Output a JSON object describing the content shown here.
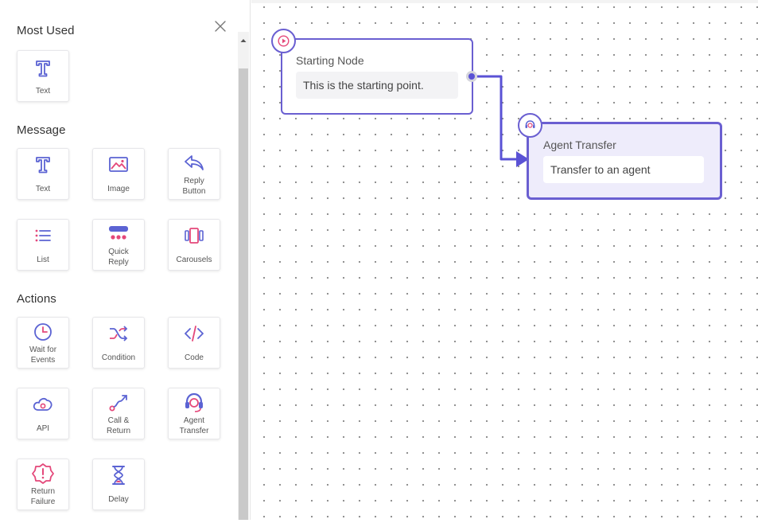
{
  "sidebar": {
    "sections": {
      "most_used": "Most Used",
      "message": "Message",
      "actions": "Actions"
    },
    "most_used_items": [
      {
        "label": "Text",
        "icon": "text-icon"
      }
    ],
    "message_items": [
      {
        "label": "Text",
        "icon": "text-icon"
      },
      {
        "label": "Image",
        "icon": "image-icon"
      },
      {
        "label": "Reply\nButton",
        "icon": "reply-icon"
      },
      {
        "label": "List",
        "icon": "list-icon"
      },
      {
        "label": "Quick\nReply",
        "icon": "quick-reply-icon"
      },
      {
        "label": "Carousels",
        "icon": "carousel-icon"
      }
    ],
    "action_items": [
      {
        "label": "Wait for\nEvents",
        "icon": "clock-icon"
      },
      {
        "label": "Condition",
        "icon": "shuffle-icon"
      },
      {
        "label": "Code",
        "icon": "code-icon"
      },
      {
        "label": "API",
        "icon": "cloud-api-icon"
      },
      {
        "label": "Call &\nReturn",
        "icon": "call-return-icon"
      },
      {
        "label": "Agent\nTransfer",
        "icon": "headset-icon"
      },
      {
        "label": "Return\nFailure",
        "icon": "alert-icon"
      },
      {
        "label": "Delay",
        "icon": "hourglass-icon"
      }
    ]
  },
  "canvas": {
    "nodes": {
      "start": {
        "title": "Starting Node",
        "body": "This is the starting point."
      },
      "agent": {
        "title": "Agent Transfer",
        "body": "Transfer to an agent"
      }
    }
  },
  "colors": {
    "accent": "#6a5fd1",
    "icon_blue": "#5b63d3",
    "icon_pink": "#e4487a",
    "selected_node_bg": "#eeecfb"
  }
}
